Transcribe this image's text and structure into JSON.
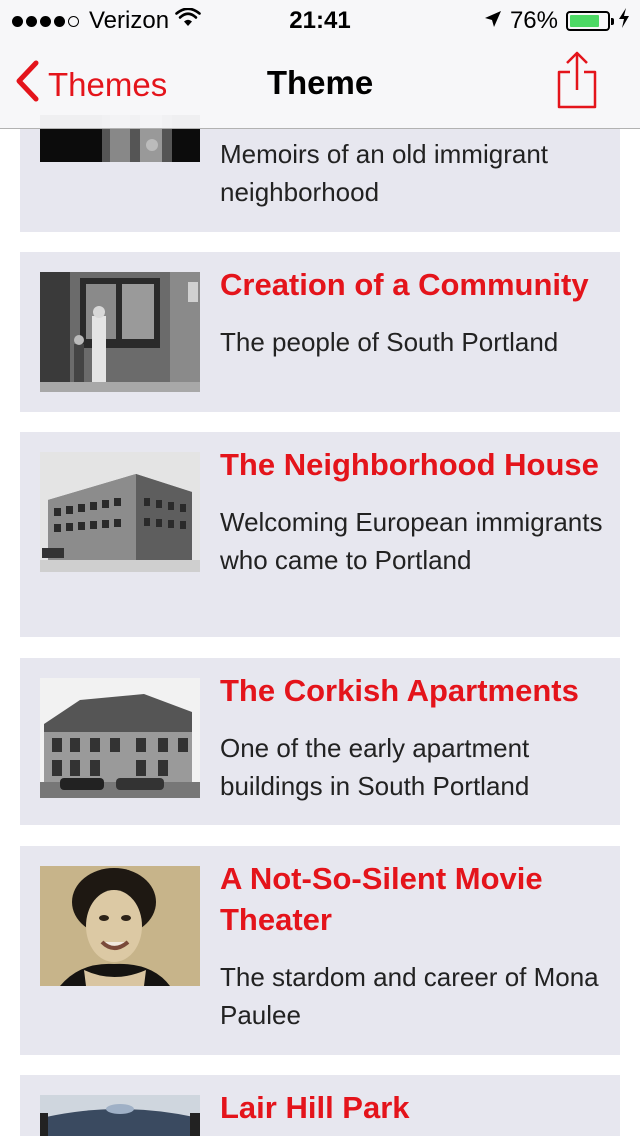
{
  "status_bar": {
    "carrier": "Verizon",
    "time": "21:41",
    "battery": "76%"
  },
  "nav": {
    "back_label": "Themes",
    "title": "Theme"
  },
  "items": [
    {
      "title": "",
      "description": "Memoirs of an old immigrant neighborhood"
    },
    {
      "title": "Creation of a Community",
      "description": "The people of South Portland"
    },
    {
      "title": "The Neighborhood House",
      "description": "Welcoming European immigrants who came to Portland"
    },
    {
      "title": "The Corkish Apartments",
      "description": "One of the early apartment buildings in South Portland"
    },
    {
      "title": "A Not-So-Silent Movie Theater",
      "description": "The stardom and career of Mona Paulee"
    },
    {
      "title": "Lair Hill Park",
      "description": ""
    }
  ],
  "colors": {
    "accent": "#e4141b",
    "card_bg": "#e7e7ef"
  }
}
